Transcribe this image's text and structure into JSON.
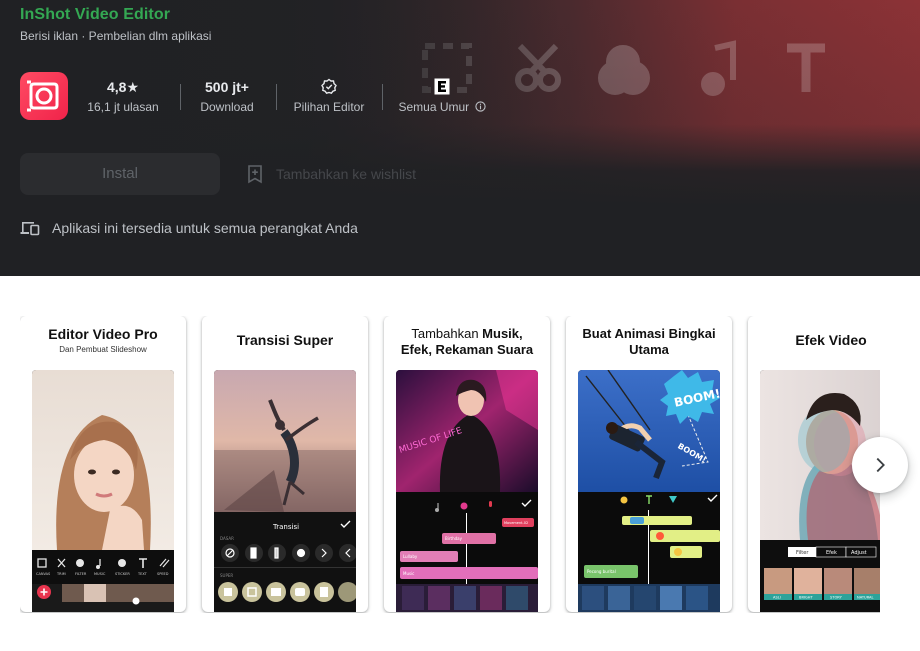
{
  "app": {
    "title": "InShot Video Editor",
    "subtitle": "Berisi iklan · Pembelian dlm aplikasi",
    "icon": "inshot-logo-icon",
    "accent_color": "#34a853",
    "brand_color": "#f0234a"
  },
  "stats": [
    {
      "value": "4,8★",
      "label": "16,1 jt ulasan"
    },
    {
      "value": "500 jt+",
      "label": "Download"
    },
    {
      "icon": "editors-choice-badge-icon",
      "label": "Pilihan Editor"
    },
    {
      "icon": "rating-e-icon",
      "label": "Semua Umur",
      "info_icon": "info-icon"
    }
  ],
  "actions": {
    "install_label": "Instal",
    "wishlist_label": "Tambahkan ke wishlist"
  },
  "devices_label": "Aplikasi ini tersedia untuk semua perangkat Anda",
  "screenshots": [
    {
      "title": "Editor Video Pro",
      "subtitle": "Dan Pembuat Slideshow",
      "tools": [
        "CANVAS",
        "TRIM",
        "FILTER",
        "MUSIC",
        "STICKER",
        "TEXT",
        "SPEED"
      ]
    },
    {
      "title": "Transisi Super",
      "panel_title": "Transisi",
      "rows": [
        "DASAR",
        "SUPER"
      ]
    },
    {
      "title_prefix": "Tambahkan ",
      "title_bold_1": "Musik,",
      "title_line2": "Efek, Rekaman Suara",
      "overlay_text": "MUSIC OF LIFE",
      "clips": [
        "Movement-02",
        "Birthday",
        "Lullaby",
        "Music"
      ]
    },
    {
      "title": "Buat Animasi Bingkai Utama",
      "sticker_text": "BOOM!",
      "clip": "Pecong burital"
    },
    {
      "title": "Efek Video",
      "tabs": [
        "Filter",
        "Efek",
        "Adjust"
      ],
      "thumbs": [
        "ASLI",
        "BRIGHT",
        "STORY",
        "NATURAL"
      ]
    }
  ],
  "nav": {
    "next_icon": "chevron-right-icon"
  }
}
